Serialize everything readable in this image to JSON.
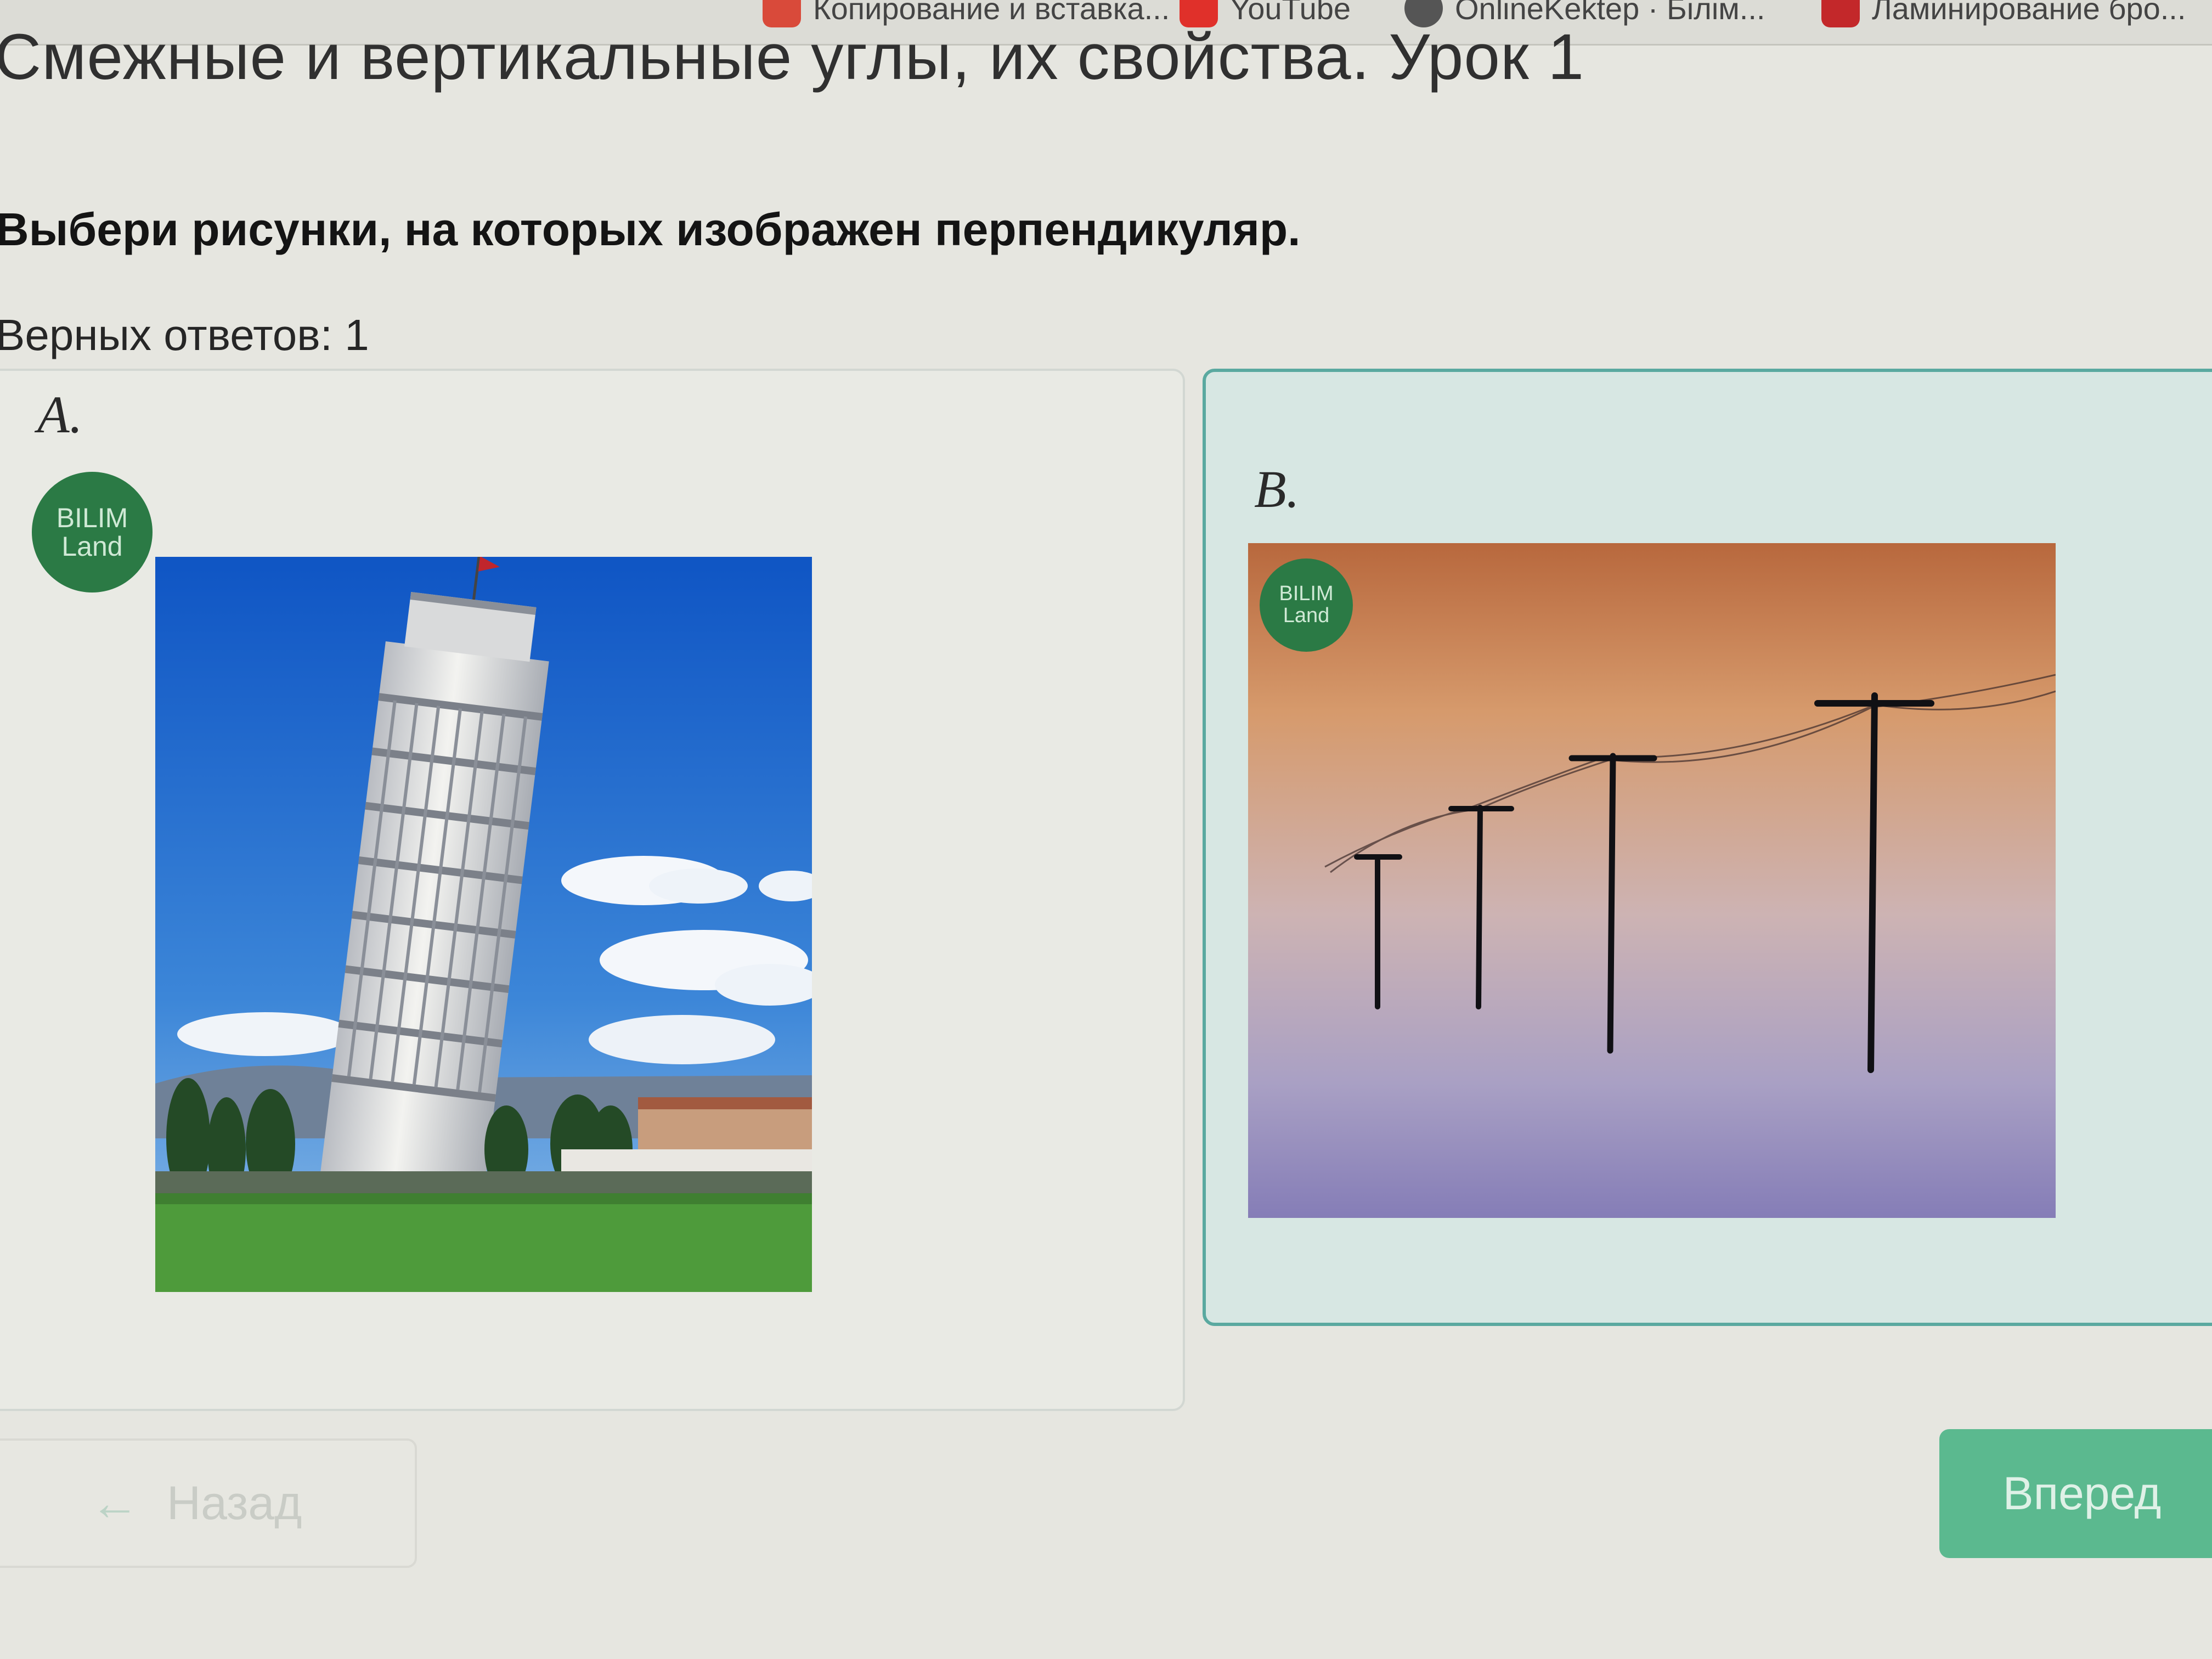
{
  "bookmarks": [
    {
      "label": "Копирование и вставка...",
      "color": "#d94a3a"
    },
    {
      "label": "YouTube",
      "color": "#e0302a"
    },
    {
      "label": "OnlineKektep · Білім...",
      "color": "#555555"
    },
    {
      "label": "Ламинирование бро...",
      "color": "#c3282a"
    }
  ],
  "page": {
    "title": "Смежные и вертикальные углы, их свойства. Урок 1",
    "question": "Выбери рисунки, на которых изображен перпендикуляр.",
    "answers_count": "Верных ответов: 1"
  },
  "options": [
    {
      "letter": "A.",
      "image": "leaning-tower-photo",
      "selected": false
    },
    {
      "letter": "B.",
      "image": "utility-poles-illustration",
      "selected": true
    }
  ],
  "logo": {
    "line1": "BILIM",
    "line2": "Land",
    "color": "#2b7a45"
  },
  "nav": {
    "back_label": "Назад",
    "next_label": "Вперед"
  },
  "colors": {
    "accent": "#5bb98f",
    "selected_border": "#5aa9a0"
  }
}
